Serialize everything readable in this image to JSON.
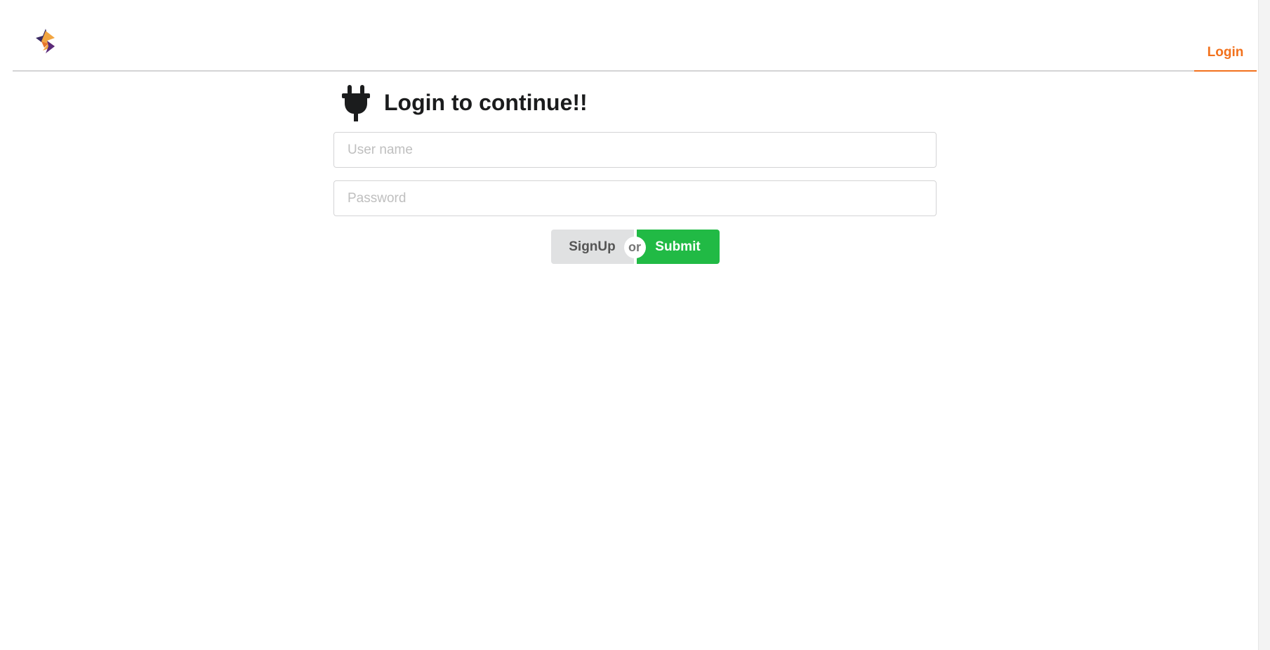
{
  "nav": {
    "logo_icon": "star-lightning-logo-icon",
    "login_label": "Login",
    "accent_color": "#f2711c"
  },
  "form": {
    "heading_icon": "plug-icon",
    "heading": "Login to continue!!",
    "username_placeholder": "User name",
    "password_placeholder": "Password",
    "signup_label": "SignUp",
    "or_label": "or",
    "submit_label": "Submit",
    "submit_color": "#21ba45"
  }
}
